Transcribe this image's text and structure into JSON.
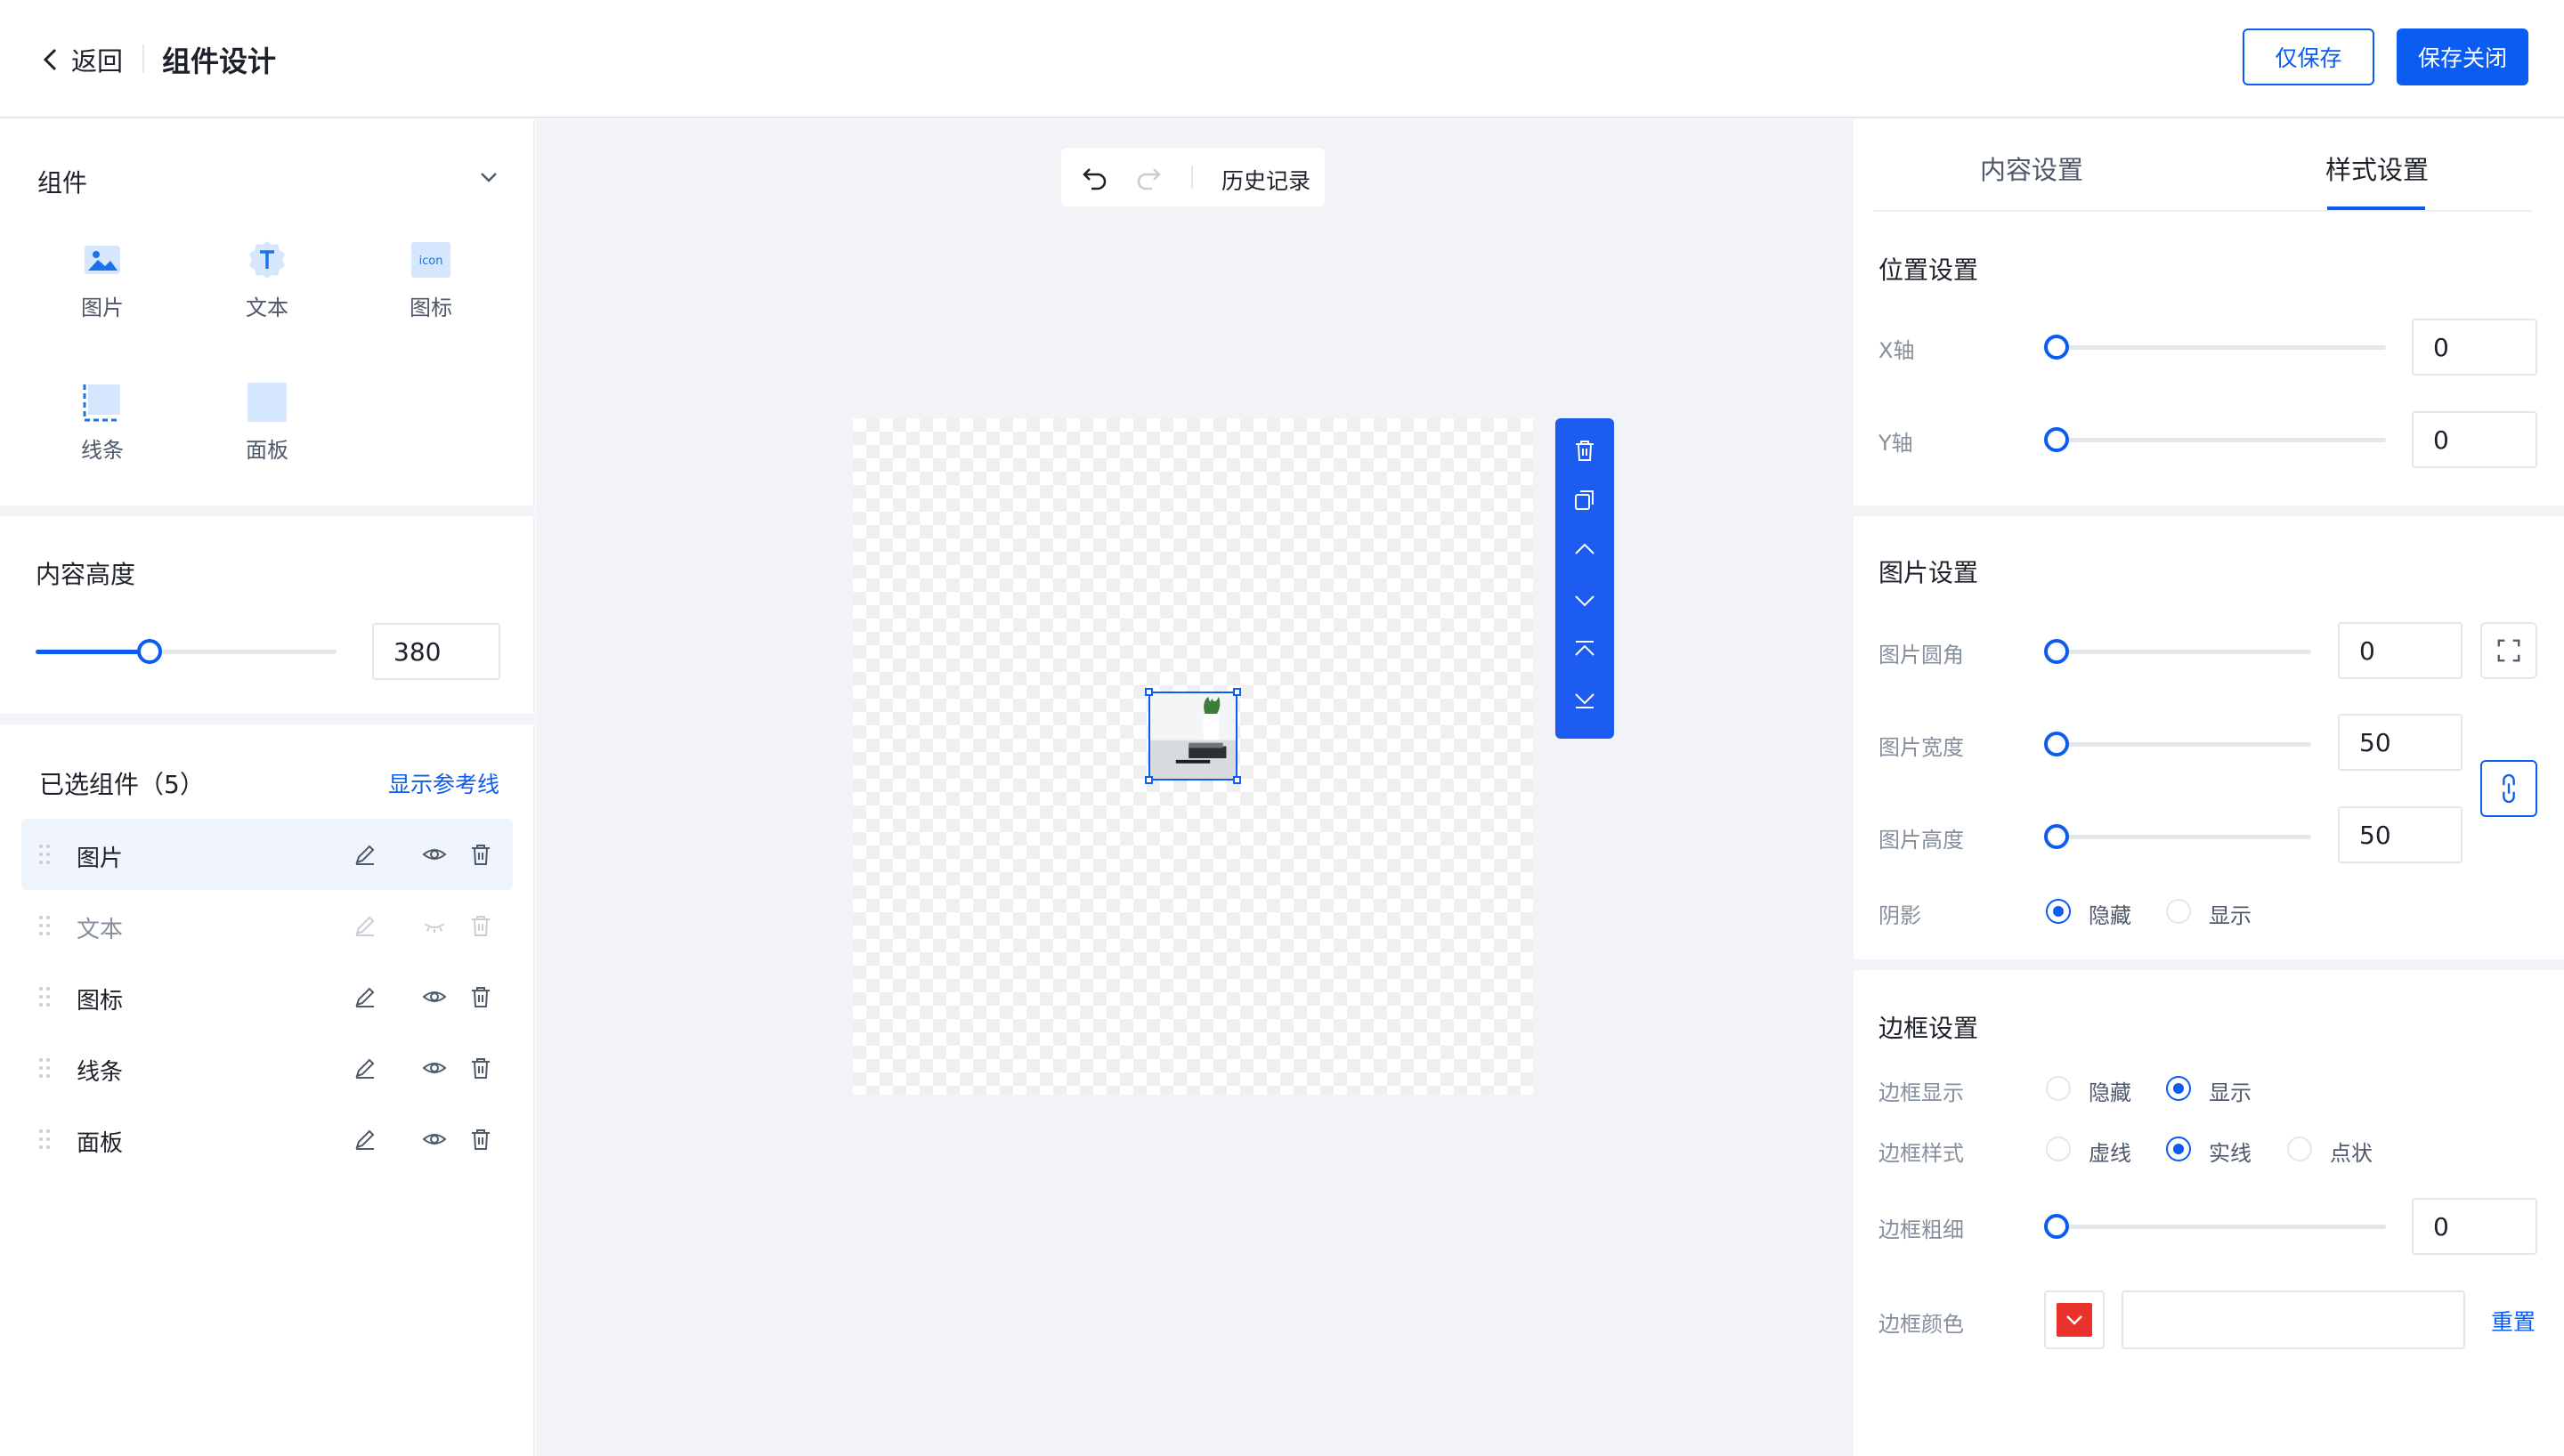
{
  "header": {
    "back_label": "返回",
    "title": "组件设计",
    "save_only": "仅保存",
    "save_close": "保存关闭"
  },
  "left": {
    "components_title": "组件",
    "components": [
      {
        "label": "图片",
        "icon": "image-icon"
      },
      {
        "label": "文本",
        "icon": "text-icon"
      },
      {
        "label": "图标",
        "icon": "icon-icon",
        "badge": "icon"
      },
      {
        "label": "线条",
        "icon": "line-icon"
      },
      {
        "label": "面板",
        "icon": "panel-icon"
      }
    ],
    "content_height_title": "内容高度",
    "content_height_value": "380",
    "content_height_fraction": 0.38,
    "selected_title": "已选组件（5）",
    "show_guides": "显示参考线",
    "layers": [
      {
        "label": "图片",
        "active": true,
        "visible": true
      },
      {
        "label": "文本",
        "active": false,
        "visible": false
      },
      {
        "label": "图标",
        "active": false,
        "visible": true
      },
      {
        "label": "线条",
        "active": false,
        "visible": true
      },
      {
        "label": "面板",
        "active": false,
        "visible": true
      }
    ]
  },
  "canvas": {
    "history_label": "历史记录"
  },
  "right": {
    "tabs": [
      "内容设置",
      "样式设置"
    ],
    "active_tab": "样式设置",
    "position": {
      "title": "位置设置",
      "x_label": "X轴",
      "x_value": "0",
      "y_label": "Y轴",
      "y_value": "0"
    },
    "image": {
      "title": "图片设置",
      "radius_label": "图片圆角",
      "radius_value": "0",
      "width_label": "图片宽度",
      "width_value": "50",
      "height_label": "图片高度",
      "height_value": "50",
      "shadow_label": "阴影",
      "shadow_hide": "隐藏",
      "shadow_show": "显示",
      "shadow_selected": "隐藏"
    },
    "border": {
      "title": "边框设置",
      "display_label": "边框显示",
      "display_hide": "隐藏",
      "display_show": "显示",
      "display_selected": "显示",
      "style_label": "边框样式",
      "style_dashed": "虚线",
      "style_solid": "实线",
      "style_dotted": "点状",
      "style_selected": "实线",
      "width_label": "边框粗细",
      "width_value": "0",
      "color_label": "边框颜色",
      "color_value": "#e8322b",
      "reset": "重置"
    }
  },
  "colors": {
    "primary": "#0b5cf0",
    "panel_bg": "#f2f3f7"
  }
}
